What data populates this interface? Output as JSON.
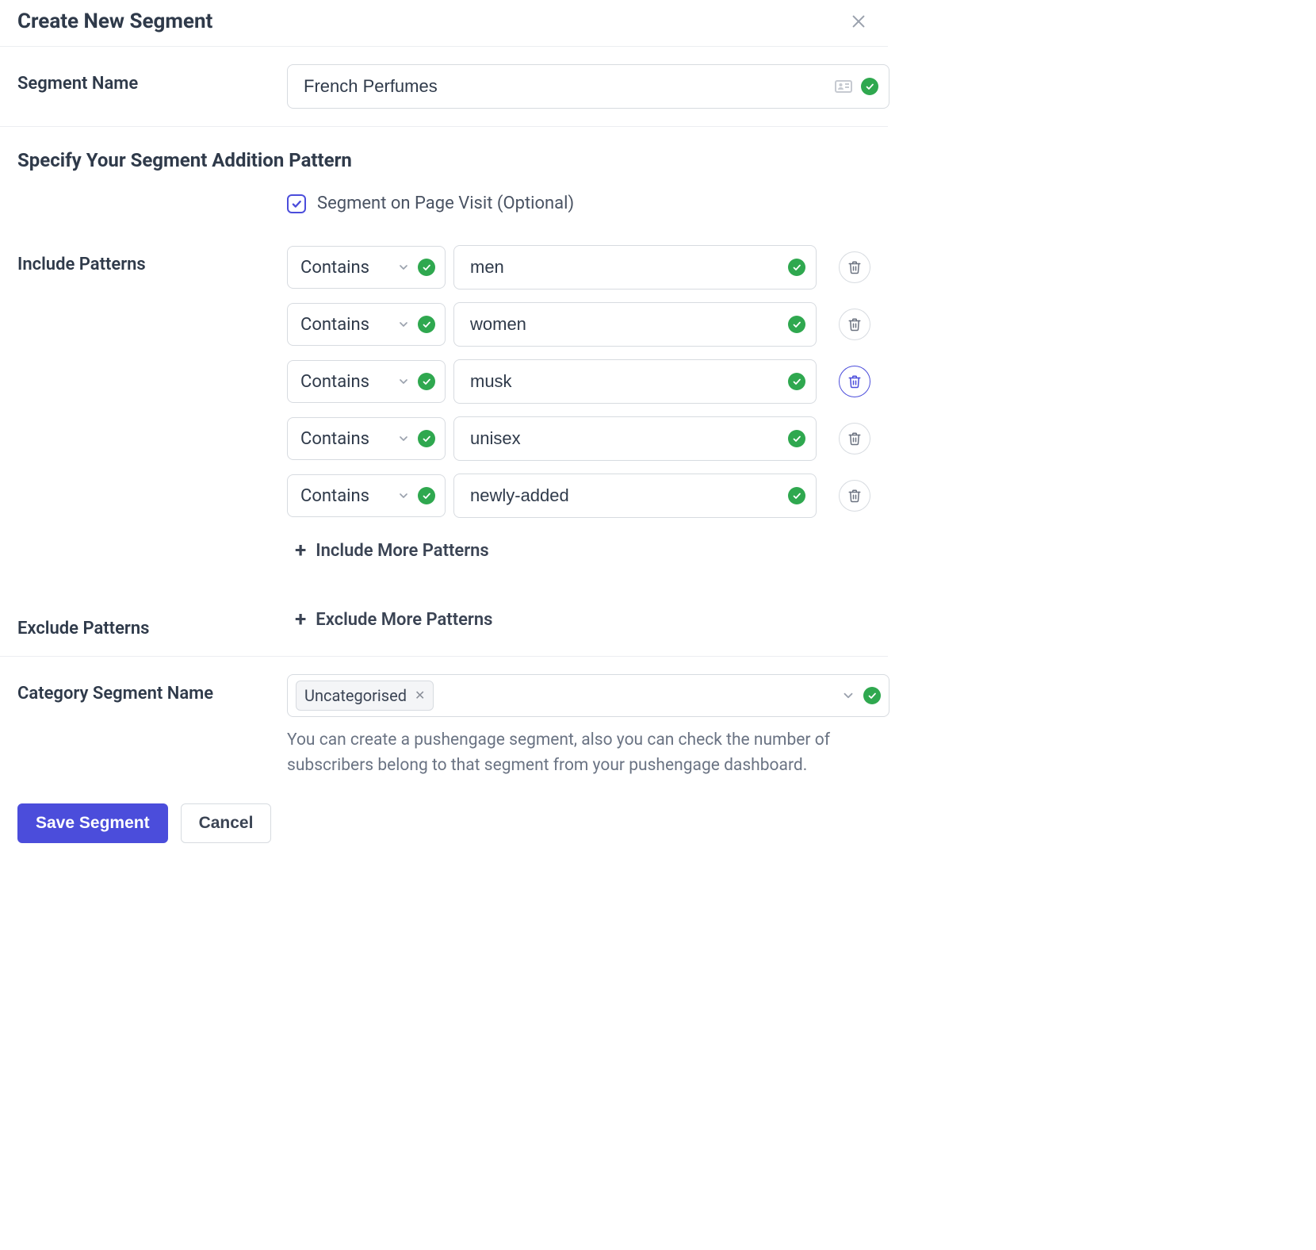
{
  "modal": {
    "title": "Create New Segment"
  },
  "segmentName": {
    "label": "Segment Name",
    "value": "French Perfumes",
    "valid": true
  },
  "patternSection": {
    "title": "Specify Your Segment Addition Pattern",
    "pageVisit": {
      "checked": true,
      "label": "Segment on Page Visit (Optional)"
    }
  },
  "include": {
    "label": "Include Patterns",
    "addMoreLabel": "Include More Patterns",
    "rows": [
      {
        "op": "Contains",
        "value": "men",
        "deleteActive": false
      },
      {
        "op": "Contains",
        "value": "women",
        "deleteActive": false
      },
      {
        "op": "Contains",
        "value": "musk",
        "deleteActive": true
      },
      {
        "op": "Contains",
        "value": "unisex",
        "deleteActive": false
      },
      {
        "op": "Contains",
        "value": "newly-added",
        "deleteActive": false
      }
    ]
  },
  "exclude": {
    "label": "Exclude Patterns",
    "addMoreLabel": "Exclude More Patterns"
  },
  "category": {
    "label": "Category Segment Name",
    "chip": "Uncategorised",
    "help": "You can create a pushengage segment, also you can check the number of subscribers belong to that segment from your pushengage dashboard."
  },
  "footer": {
    "save": "Save Segment",
    "cancel": "Cancel"
  }
}
